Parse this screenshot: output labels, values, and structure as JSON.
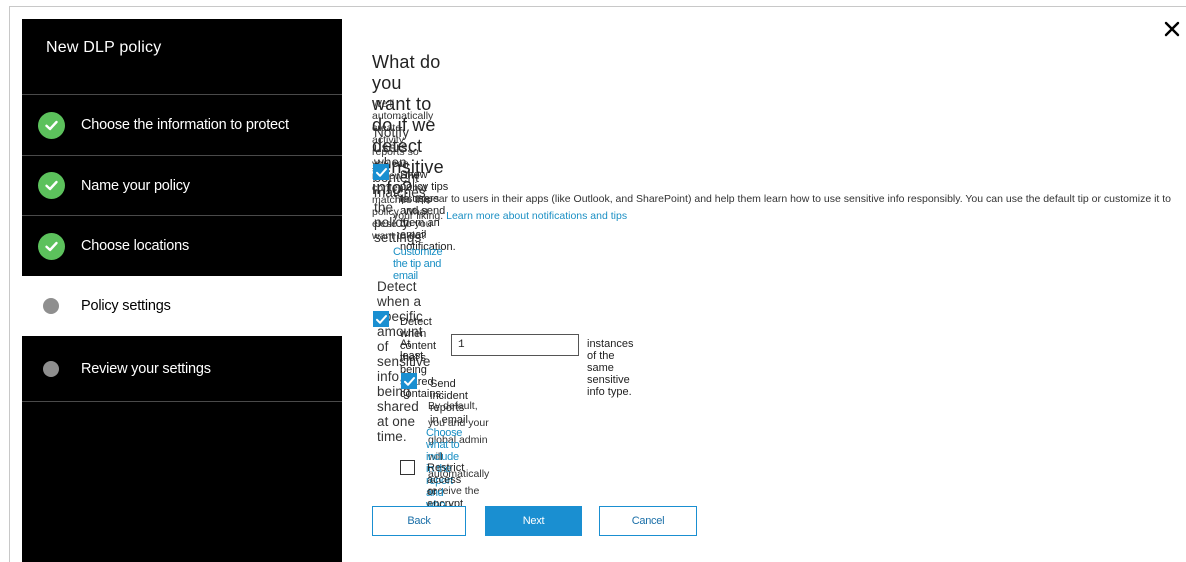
{
  "sidebar": {
    "title": "New DLP policy",
    "steps": [
      {
        "label": "Choose the information to protect",
        "state": "done"
      },
      {
        "label": "Name your policy",
        "state": "done"
      },
      {
        "label": "Choose locations",
        "state": "done"
      },
      {
        "label": "Policy settings",
        "state": "current"
      },
      {
        "label": "Review your settings",
        "state": "pending"
      }
    ]
  },
  "dialog": {
    "close_icon": "close-icon"
  },
  "main": {
    "heading": "What do you want to do if we detect sensitive info?",
    "intro": "We'll automatically create activity reports so you can review the content that matches this policy. What elese do you want to do?",
    "notify_heading": "Notify users when content matches the policy settings",
    "policy_tips": {
      "checked": true,
      "label": "Show policy tips to users and send them an email notification.",
      "description": "Tips appear to users in their apps (like Outlook, and SharePoint) and help them learn how to use sensitive info responsibly. You can use the default tip or customize it to your liking.",
      "learn_more_link": "Learn more about notifications and tips",
      "customize_link": "Customize the tip and email"
    },
    "detect_heading": "Detect when a specific amount of sensitive info is being shared at one time.",
    "detect": {
      "checked": true,
      "label": "Detect when content that's being shared contains:",
      "at_least_label": "At least",
      "instances_value": "1",
      "instances_suffix": "instances of the same sensitive info type."
    },
    "incident_reports": {
      "checked": true,
      "label": "Send incident reports in email",
      "description": "By default, you and your global admin will automatically receive the email.",
      "choose_link": "Choose what to include in the report and who receives it"
    },
    "restrict": {
      "checked": false,
      "label": "Restrict access or encrypt the content"
    }
  },
  "buttons": {
    "back": "Back",
    "next": "Next",
    "cancel": "Cancel"
  },
  "colors": {
    "accent": "#1a8fd1",
    "done": "#5cc15c",
    "pending": "#8f8f8f",
    "sidebar_bg": "#000000"
  }
}
